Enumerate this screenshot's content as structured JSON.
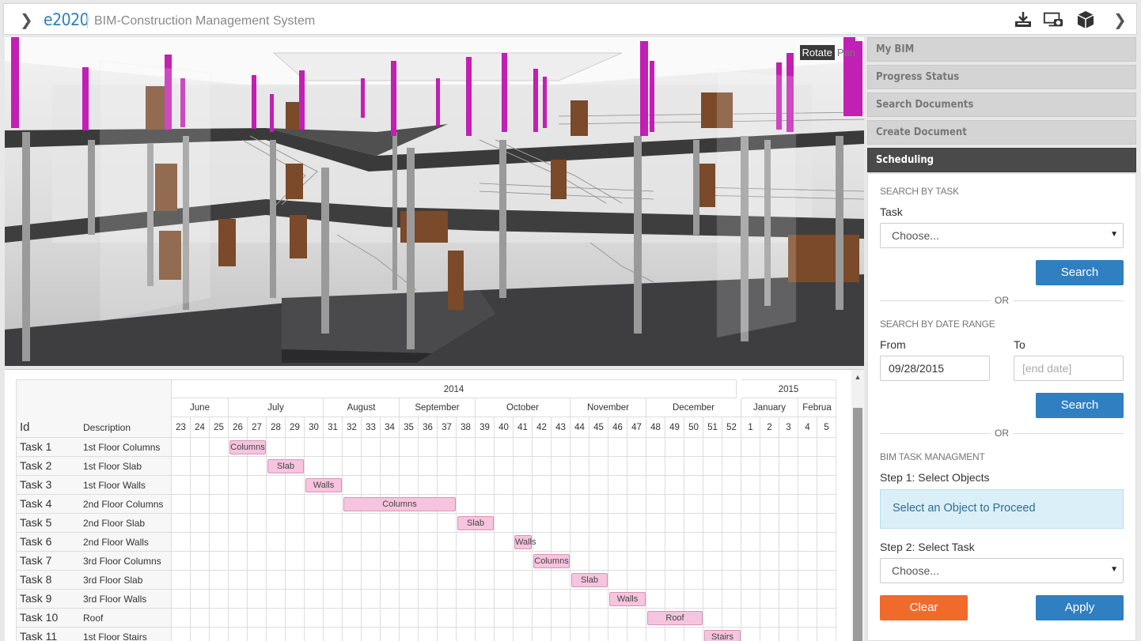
{
  "header": {
    "brand": "e2020",
    "title": "BIM-Construction Management System",
    "toolbar_icons": [
      "download-icon",
      "screenshot-icon",
      "cube-icon",
      "chevron-right-icon"
    ]
  },
  "viewer": {
    "modes": [
      "Rotate",
      "Pan"
    ],
    "active_mode": "Rotate"
  },
  "gantt": {
    "columns": {
      "id": "Id",
      "description": "Description"
    },
    "years": [
      {
        "label": "2014"
      },
      {
        "label": "2015"
      }
    ],
    "months": [
      "June",
      "July",
      "August",
      "September",
      "October",
      "November",
      "December",
      "January",
      "Februa"
    ],
    "weeks": [
      "23",
      "24",
      "25",
      "26",
      "27",
      "28",
      "29",
      "30",
      "31",
      "32",
      "33",
      "34",
      "35",
      "36",
      "37",
      "38",
      "39",
      "40",
      "41",
      "42",
      "43",
      "44",
      "45",
      "46",
      "47",
      "48",
      "49",
      "50",
      "51",
      "52",
      "1",
      "2",
      "3",
      "4",
      "5"
    ],
    "tasks": [
      {
        "id": "Task 1",
        "description": "1st Floor Columns",
        "bar": "Columns",
        "start_week": "26",
        "end_week": "28"
      },
      {
        "id": "Task 2",
        "description": "1st Floor Slab",
        "bar": "Slab",
        "start_week": "28",
        "end_week": "30"
      },
      {
        "id": "Task 3",
        "description": "1st Floor Walls",
        "bar": "Walls",
        "start_week": "30",
        "end_week": "32"
      },
      {
        "id": "Task 4",
        "description": "2nd Floor Columns",
        "bar": "Columns",
        "start_week": "32",
        "end_week": "38"
      },
      {
        "id": "Task 5",
        "description": "2nd Floor Slab",
        "bar": "Slab",
        "start_week": "38",
        "end_week": "40"
      },
      {
        "id": "Task 6",
        "description": "2nd Floor Walls",
        "bar": "Walls",
        "start_week": "41",
        "end_week": "42"
      },
      {
        "id": "Task 7",
        "description": "3rd Floor Columns",
        "bar": "Columns",
        "start_week": "42",
        "end_week": "44"
      },
      {
        "id": "Task 8",
        "description": "3rd Floor Slab",
        "bar": "Slab",
        "start_week": "44",
        "end_week": "46"
      },
      {
        "id": "Task 9",
        "description": "3rd Floor Walls",
        "bar": "Walls",
        "start_week": "46",
        "end_week": "48"
      },
      {
        "id": "Task 10",
        "description": "Roof",
        "bar": "Roof",
        "start_week": "48",
        "end_week": "51"
      },
      {
        "id": "Task 11",
        "description": "1st Floor Stairs",
        "bar": "Stairs",
        "start_week": "51",
        "end_week": "1"
      }
    ]
  },
  "sidebar": {
    "sections": [
      "My BIM",
      "Progress Status",
      "Search Documents",
      "Create Document",
      "Scheduling"
    ],
    "active_section": "Scheduling",
    "scheduling": {
      "search_by_task_title": "SEARCH BY TASK",
      "task_label": "Task",
      "task_select": "Choose...",
      "search_button": "Search",
      "or_text": "OR",
      "search_by_date_title": "SEARCH BY DATE RANGE",
      "from_label": "From",
      "to_label": "To",
      "from_value": "09/28/2015",
      "to_placeholder": "[end date]",
      "bim_task_title": "BIM TASK MANAGMENT",
      "step1_label": "Step 1: Select Objects",
      "info_text": "Select an Object to Proceed",
      "step2_label": "Step 2: Select Task",
      "step2_select": "Choose...",
      "clear_button": "Clear",
      "apply_button": "Apply"
    }
  },
  "colors": {
    "accent": "#2f7fc1",
    "clear": "#f06a2b",
    "gantt_bar": "#f6c4de",
    "columns": "#c21fb5"
  }
}
